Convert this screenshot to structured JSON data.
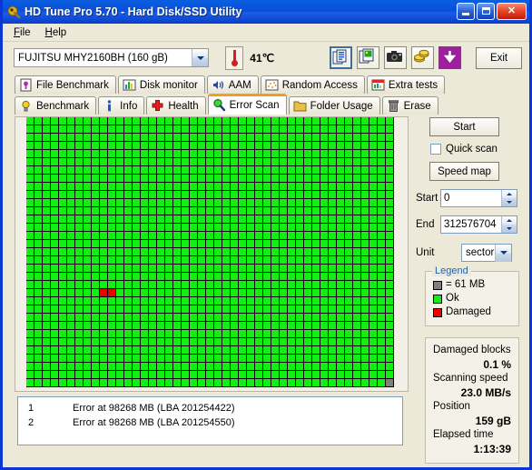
{
  "window": {
    "title": "HD Tune Pro 5.70 - Hard Disk/SSD Utility",
    "icon": "app-icon",
    "minimize_label": "Minimize",
    "maximize_label": "Maximize",
    "close_label": "Close",
    "accent_titlebar": "#0a4fd8",
    "accent_tab": "#f29d1f"
  },
  "menu": {
    "items": [
      {
        "label": "File",
        "accel": "F"
      },
      {
        "label": "Help",
        "accel": "H"
      }
    ]
  },
  "toolbar": {
    "drive": {
      "value": "FUJITSU MHY2160BH (160 gB)",
      "icon": "chevron-down-icon"
    },
    "temperature": {
      "icon": "thermometer-icon",
      "value": "41℃"
    },
    "buttons": [
      {
        "name": "copy-text-button",
        "icon": "copy-text-icon",
        "focused": true
      },
      {
        "name": "copy-image-button",
        "icon": "copy-image-icon",
        "focused": false
      },
      {
        "name": "screenshot-button",
        "icon": "camera-icon",
        "focused": false
      },
      {
        "name": "donate-button",
        "icon": "coins-icon",
        "focused": false
      },
      {
        "name": "save-button",
        "icon": "down-arrow-icon",
        "focused": false
      }
    ],
    "exit_label": "Exit"
  },
  "tabs": {
    "row1": [
      {
        "label": "File Benchmark",
        "icon": "file-benchmark-icon",
        "active": false
      },
      {
        "label": "Disk monitor",
        "icon": "bar-chart-icon",
        "active": false
      },
      {
        "label": "AAM",
        "icon": "speaker-icon",
        "active": false
      },
      {
        "label": "Random Access",
        "icon": "scatter-icon",
        "active": false
      },
      {
        "label": "Extra tests",
        "icon": "extra-tests-icon",
        "active": false
      }
    ],
    "row2": [
      {
        "label": "Benchmark",
        "icon": "lightbulb-icon",
        "active": false
      },
      {
        "label": "Info",
        "icon": "info-icon",
        "active": false
      },
      {
        "label": "Health",
        "icon": "health-cross-icon",
        "active": false
      },
      {
        "label": "Error Scan",
        "icon": "magnifier-icon",
        "active": true
      },
      {
        "label": "Folder Usage",
        "icon": "folder-icon",
        "active": false
      },
      {
        "label": "Erase",
        "icon": "trash-icon",
        "active": false
      }
    ]
  },
  "scan": {
    "columns": 45,
    "rows": 33,
    "colors": {
      "ok": "#13ef13",
      "damaged": "#ee0000",
      "unscanned": "#808080",
      "grid": "#000000"
    },
    "damaged_cells": [
      {
        "row": 21,
        "col": 9
      },
      {
        "row": 21,
        "col": 10
      }
    ],
    "unscanned_cells": [
      {
        "row": 32,
        "col": 44
      }
    ]
  },
  "errors": {
    "rows": [
      {
        "index": "1",
        "text": "Error at 98268 MB (LBA 201254422)"
      },
      {
        "index": "2",
        "text": "Error at 98268 MB (LBA 201254550)"
      }
    ]
  },
  "controls": {
    "start_label": "Start",
    "quick_scan_label": "Quick scan",
    "quick_scan_checked": false,
    "speed_map_label": "Speed map",
    "start_field": {
      "label": "Start",
      "value": "0"
    },
    "end_field": {
      "label": "End",
      "value": "312576704"
    },
    "unit_field": {
      "label": "Unit",
      "value": "sector"
    }
  },
  "legend": {
    "title": "Legend",
    "block_size": "= 61 MB",
    "ok_label": "Ok",
    "damaged_label": "Damaged"
  },
  "stats": {
    "damaged_blocks_label": "Damaged blocks",
    "damaged_blocks_value": "0.1 %",
    "scanning_speed_label": "Scanning speed",
    "scanning_speed_value": "23.0 MB/s",
    "position_label": "Position",
    "position_value": "159 gB",
    "elapsed_label": "Elapsed time",
    "elapsed_value": "1:13:39"
  }
}
